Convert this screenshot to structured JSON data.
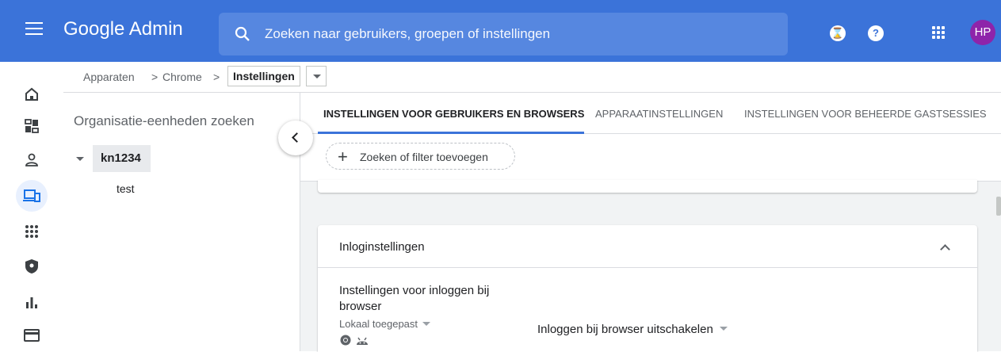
{
  "header": {
    "app_title": "Google Admin",
    "search_placeholder": "Zoeken naar gebruikers, groepen of instellingen",
    "icons": [
      "menu-icon",
      "search-icon",
      "hourglass-icon",
      "help-icon",
      "apps-grid-icon"
    ],
    "avatar_initials": "HP",
    "avatar_color": "#8e24aa",
    "brand_color": "#3b73d9"
  },
  "breadcrumb": {
    "items": [
      "Apparaten",
      "Chrome"
    ],
    "separator": ">",
    "current": "Instellingen"
  },
  "rail": {
    "items": [
      "home-icon",
      "dashboard-icon",
      "users-icon",
      "devices-icon",
      "apps-icon",
      "security-icon",
      "reports-icon",
      "billing-icon"
    ],
    "active": "devices-icon"
  },
  "org_panel": {
    "search_placeholder": "Organisatie-eenheden zoeken",
    "root": "kn1234",
    "children": [
      "test"
    ]
  },
  "tabs": [
    {
      "label": "INSTELLINGEN VOOR GEBRUIKERS EN BROWSERS",
      "active": true
    },
    {
      "label": "APPARAATINSTELLINGEN",
      "active": false
    },
    {
      "label": "INSTELLINGEN VOOR BEHEERDE GASTSESSIES",
      "active": false
    }
  ],
  "filter": {
    "label": "Zoeken of filter toevoegen"
  },
  "section": {
    "title": "Inloginstellingen",
    "setting": {
      "name": "Instellingen voor inloggen bij browser",
      "scope": "Lokaal toegepast",
      "platform_icons": [
        "chrome-icon",
        "android-icon"
      ],
      "value": "Inloggen bij browser uitschakelen"
    }
  }
}
